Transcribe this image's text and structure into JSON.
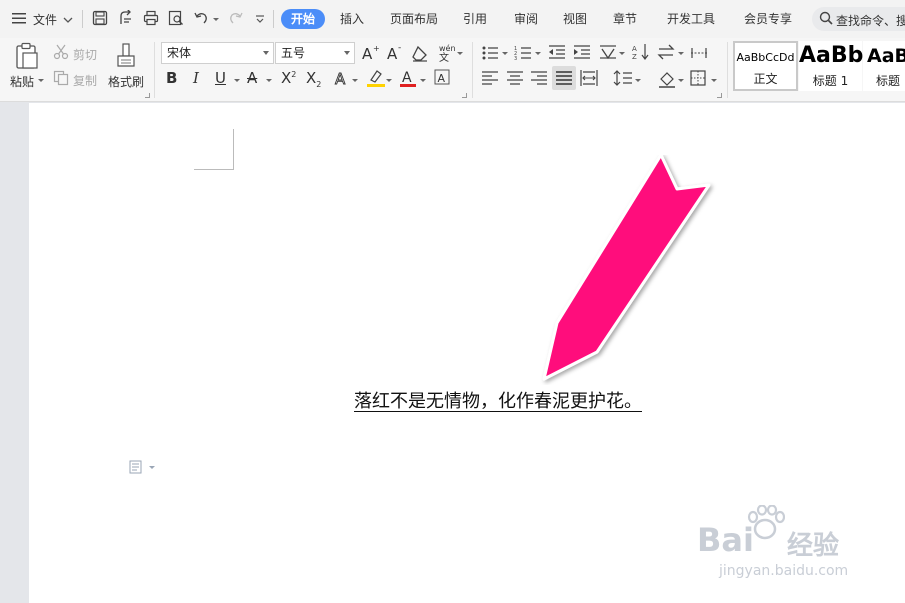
{
  "menubar": {
    "file_label": "文件",
    "tabs": [
      {
        "label": "开始",
        "active": true
      },
      {
        "label": "插入"
      },
      {
        "label": "页面布局"
      },
      {
        "label": "引用"
      },
      {
        "label": "审阅"
      },
      {
        "label": "视图"
      },
      {
        "label": "章节"
      },
      {
        "label": "开发工具"
      },
      {
        "label": "会员专享"
      }
    ],
    "search_placeholder": "查找命令、搜"
  },
  "toolbar": {
    "paste_label": "粘贴",
    "cut_label": "剪切",
    "copy_label": "复制",
    "format_painter_label": "格式刷",
    "font_name": "宋体",
    "font_size": "五号",
    "styles": [
      {
        "sample": "AaBbCcDd",
        "name": "正文"
      },
      {
        "sample": "AaBb",
        "name": "标题 1"
      },
      {
        "sample": "AaB",
        "name": "标题"
      }
    ]
  },
  "document": {
    "body_text": "落红不是无情物，化作春泥更护花。"
  },
  "watermark": {
    "brand": "Bai",
    "brand_suffix": "经验",
    "url": "jingyan.baidu.com"
  },
  "colors": {
    "accent": "#4b8df8",
    "arrow": "#ff0a7c",
    "font_color_bar": "#e02020",
    "highlight_bar": "#ffd200"
  }
}
